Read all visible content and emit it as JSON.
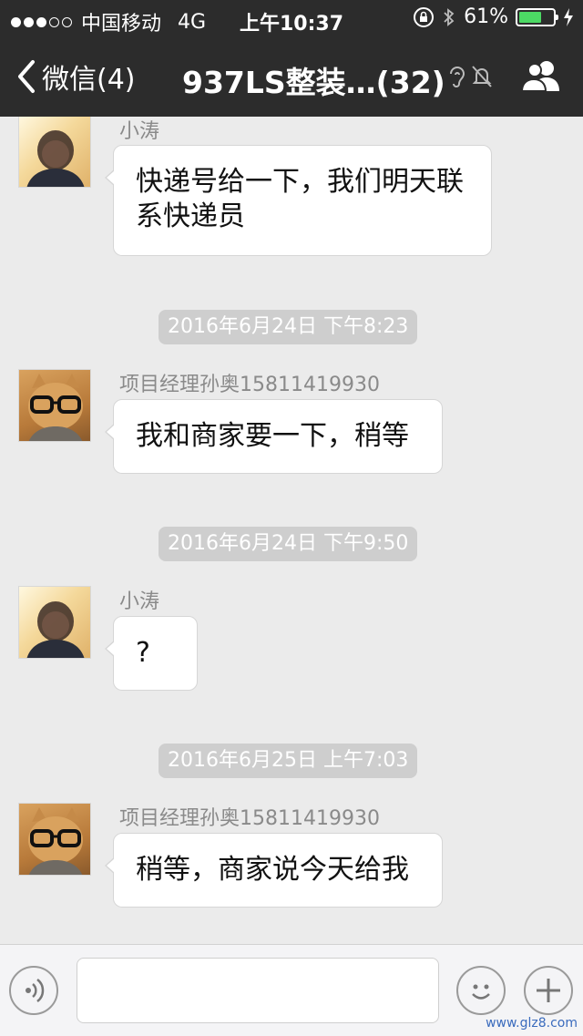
{
  "status_bar": {
    "carrier": "中国移动",
    "network": "4G",
    "time": "上午10:37",
    "battery_percent": "61%",
    "battery_level": 0.61,
    "signal_bars_filled": 3,
    "signal_bars_total": 5,
    "battery_color": "#4cd964"
  },
  "nav": {
    "back_label": "微信(4)",
    "title": "937LS整装…(32)",
    "icons": [
      "chevron-left-icon",
      "earpiece-icon",
      "mute-bell-icon",
      "group-members-icon"
    ]
  },
  "messages": [
    {
      "type": "msg",
      "sender": "小涛",
      "text": "快递号给一下，我们明天联系快递员",
      "avatar": "boy-photo"
    },
    {
      "type": "time",
      "text": "2016年6月24日  下午8:23"
    },
    {
      "type": "msg",
      "sender": "项目经理孙奥15811419930",
      "text": "我和商家要一下，稍等",
      "avatar": "cat-with-glasses"
    },
    {
      "type": "time",
      "text": "2016年6月24日  下午9:50"
    },
    {
      "type": "msg",
      "sender": "小涛",
      "text": "?",
      "avatar": "boy-photo"
    },
    {
      "type": "time",
      "text": "2016年6月25日  上午7:03"
    },
    {
      "type": "msg",
      "sender": "项目经理孙奥15811419930",
      "text": "稍等，商家说今天给我",
      "avatar": "cat-with-glasses"
    }
  ],
  "input_bar": {
    "icons": [
      "voice-icon",
      "emoji-icon",
      "plus-icon"
    ],
    "text_value": ""
  },
  "watermark": "www.glz8.com"
}
